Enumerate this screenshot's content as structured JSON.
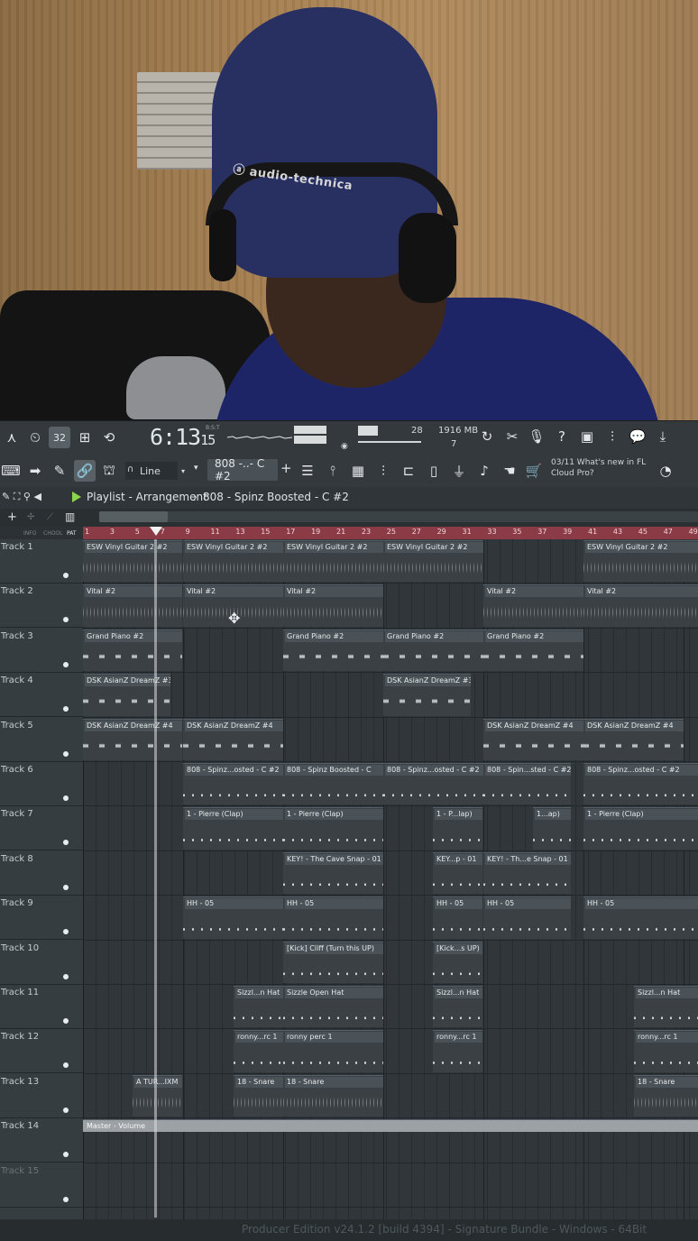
{
  "toolbar": {
    "time_main": "6:13",
    "time_sub": "15",
    "time_mode": "B:S:T",
    "tempo_display": "32",
    "cpu": "28",
    "memory": "1916 MB",
    "polyphony": "7",
    "snap_mode": "Line",
    "pattern_name": "808 -..- C #2",
    "news_line1": "03/11  What's new in FL",
    "news_line2": "Cloud Pro?"
  },
  "playlist": {
    "title": "Playlist - Arrangement",
    "separator": "›",
    "pattern": "808 - Spinz Boosted - C #2"
  },
  "ruler_ticks": [
    "1",
    "3",
    "5",
    "7",
    "9",
    "11",
    "13",
    "15",
    "17",
    "19",
    "21",
    "23",
    "25",
    "27",
    "29",
    "31",
    "33",
    "35",
    "37",
    "39",
    "41",
    "43",
    "45",
    "47",
    "49"
  ],
  "tracks": [
    "Track 1",
    "Track 2",
    "Track 3",
    "Track 4",
    "Track 5",
    "Track 6",
    "Track 7",
    "Track 8",
    "Track 9",
    "Track 10",
    "Track 11",
    "Track 12",
    "Track 13",
    "Track 14",
    "Track 15"
  ],
  "clips": {
    "t1": [
      "ESW Vinyl Guitar 2 #2",
      "ESW Vinyl Guitar 2 #2",
      "ESW Vinyl Guitar 2 #2",
      "ESW Vinyl Guitar 2 #2",
      "ESW Vinyl Guitar 2 #2"
    ],
    "t2": [
      "Vital #2",
      "Vital #2",
      "Vital #2",
      "Vital #2",
      "Vital #2"
    ],
    "t3": [
      "Grand Piano #2",
      "Grand Piano #2",
      "Grand Piano #2",
      "Grand Piano #2"
    ],
    "t4": [
      "DSK AsianZ DreamZ #3",
      "DSK AsianZ DreamZ #3"
    ],
    "t5": [
      "DSK AsianZ DreamZ #4",
      "DSK AsianZ DreamZ #4",
      "DSK AsianZ DreamZ #4",
      "DSK AsianZ DreamZ #4"
    ],
    "t6": [
      "808 - Spinz...osted - C #2",
      "808 - Spinz Boosted - C",
      "808 - Spinz...osted - C #2",
      "808 - Spin...sted - C #2",
      "808 - Spinz...osted - C #2"
    ],
    "t7": [
      "1 - Pierre (Clap)",
      "1 - Pierre (Clap)",
      "1 - P...lap)",
      "1...ap)",
      "1 - Pierre (Clap)"
    ],
    "t8": [
      "KEY! - The Cave Snap - 01",
      "KEY...p - 01",
      "KEY! - Th...e Snap - 01"
    ],
    "t9": [
      "HH - 05",
      "HH - 05",
      "HH - 05",
      "HH - 05",
      "HH - 05"
    ],
    "t10": [
      "[Kick] Cliff (Turn this UP)",
      "[Kick...s UP)"
    ],
    "t11": [
      "Sizzl...n Hat",
      "Sizzle Open Hat",
      "Sizzl...n Hat",
      "Sizzl...n Hat"
    ],
    "t12": [
      "ronny...rc 1",
      "ronny perc 1",
      "ronny...rc 1",
      "ronny...rc 1"
    ],
    "t13": [
      "A TUR...IXM",
      "18 - Snare",
      "18 - Snare",
      "18 - Snare"
    ],
    "t14": [
      "Master - Volume"
    ]
  },
  "tools_labels": [
    "INFO",
    "CHOOL",
    "PAT"
  ],
  "status_text": "Producer Edition v24.1.2 [build 4394] - Signature Bundle - Windows - 64Bit",
  "colors": {
    "ruler": "#8b3b45",
    "accent_play": "#8bd34a",
    "background": "#2b3134"
  },
  "icons": [
    "metronome-icon",
    "record-icon",
    "undo-icon",
    "save-icon",
    "mixer-icon",
    "piano-roll-icon",
    "plugin-icon",
    "help-icon",
    "microphone-icon",
    "download-icon"
  ]
}
